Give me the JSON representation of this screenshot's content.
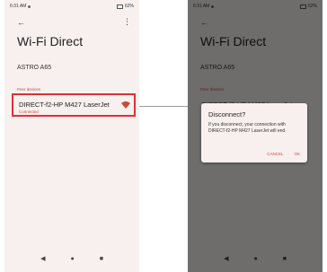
{
  "status": {
    "time": "6:31 AM",
    "battery": "62%"
  },
  "header": {
    "back_icon": "←",
    "more_icon": "⋮",
    "title": "Wi-Fi Direct"
  },
  "device_name": "ASTRO A65",
  "peer_section_label": "Peer devices",
  "peer": {
    "name": "DIRECT-f2-HP M427 LaserJet",
    "status": "Connected"
  },
  "dialog": {
    "title": "Disconnect?",
    "body": "If you disconnect, your connection with DIRECT-f2-HP M427 LaserJet will end.",
    "cancel_label": "CANCEL",
    "ok_label": "OK"
  },
  "nav": {
    "back": "◀",
    "home": "●",
    "recents": "■"
  },
  "colors": {
    "highlight": "#e03030",
    "accent": "#c94a3c",
    "background": "#f7f0ef"
  }
}
